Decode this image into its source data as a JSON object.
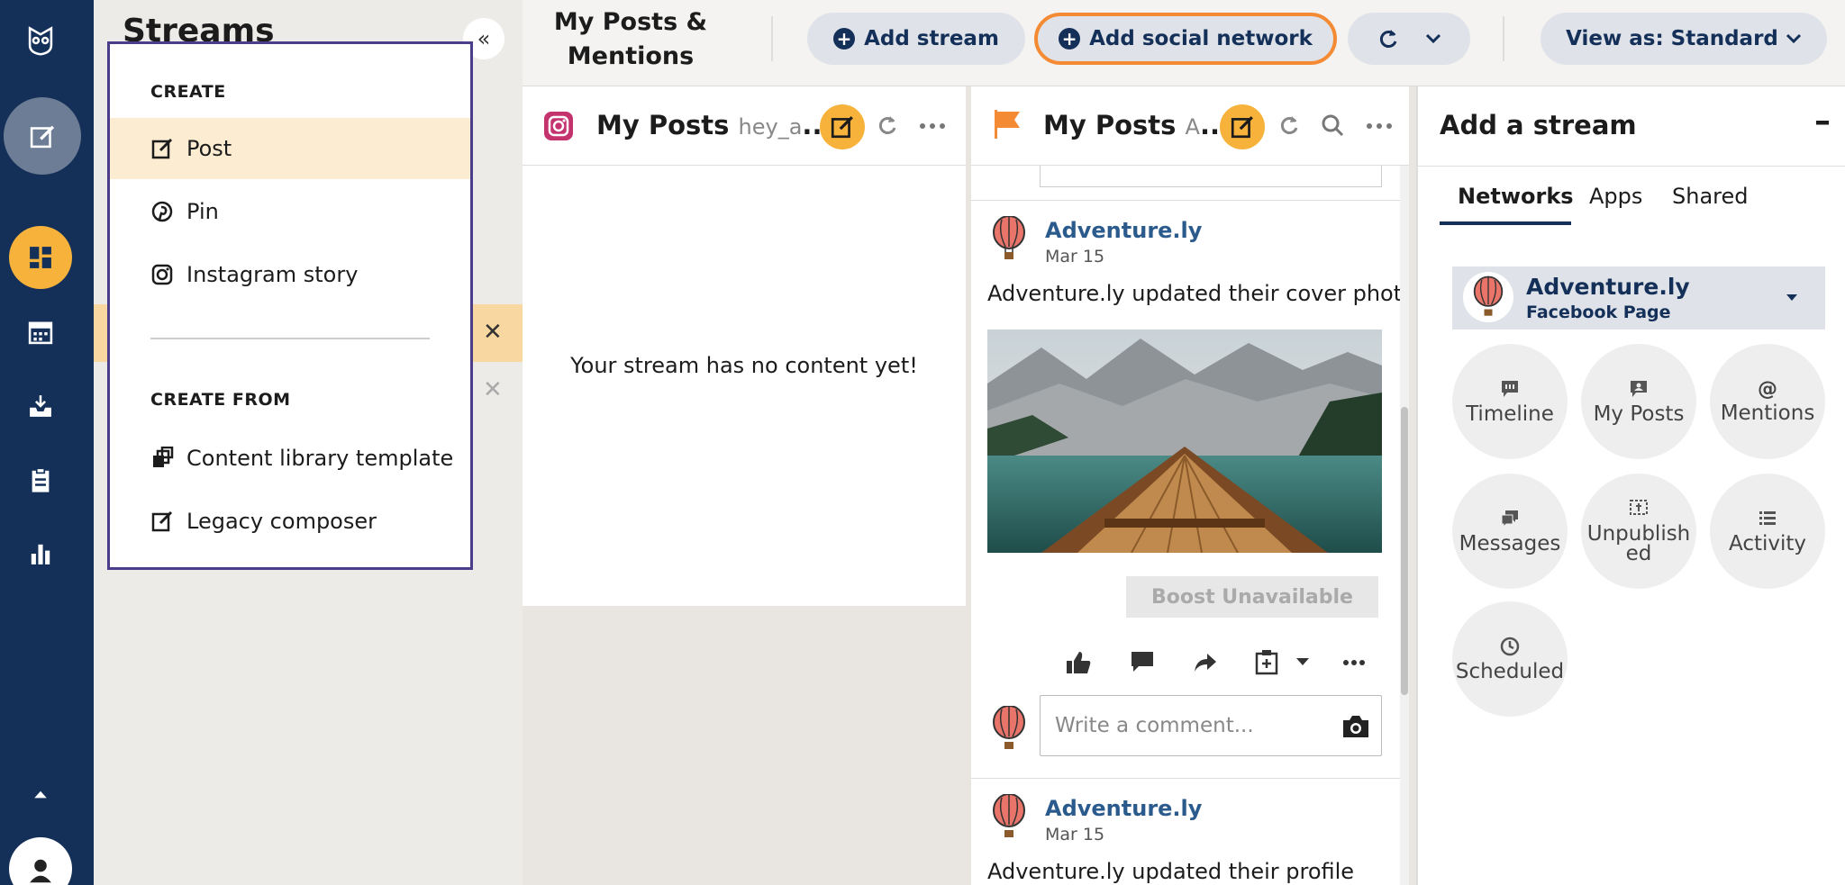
{
  "streams_panel": {
    "title": "Streams",
    "collapse_glyph": "«",
    "close_glyph": "✕"
  },
  "create_menu": {
    "create_header": "CREATE",
    "items": [
      {
        "label": "Post",
        "icon": "compose-icon"
      },
      {
        "label": "Pin",
        "icon": "pinterest-icon"
      },
      {
        "label": "Instagram story",
        "icon": "instagram-icon"
      }
    ],
    "create_from_header": "CREATE FROM",
    "from_items": [
      {
        "label": "Content library template",
        "icon": "template-icon"
      },
      {
        "label": "Legacy composer",
        "icon": "compose-icon"
      }
    ]
  },
  "topbar": {
    "title": "My Posts & Mentions",
    "add_stream": "Add stream",
    "add_social_network": "Add social network",
    "view_as": "View as: Standard"
  },
  "column1": {
    "title": "My Posts",
    "subtitle": "hey_a",
    "ellipsis": "...",
    "empty_message": "Your stream has no content yet!"
  },
  "column2": {
    "title": "My Posts",
    "subtitle": "A",
    "ellipsis": "...",
    "post1": {
      "author": "Adventure.ly",
      "date": "Mar 15",
      "text": "Adventure.ly updated their cover photo.",
      "boost": "Boost Unavailable",
      "comment_placeholder": "Write a comment..."
    },
    "post2": {
      "author": "Adventure.ly",
      "date": "Mar 15",
      "text": "Adventure.ly updated their profile"
    }
  },
  "add_panel": {
    "title": "Add a stream",
    "minimize_glyph": "–",
    "tabs": [
      "Networks",
      "Apps",
      "Shared"
    ],
    "account": {
      "name": "Adventure.ly",
      "type": "Facebook Page"
    },
    "streams": [
      {
        "label": "Timeline",
        "icon": "timeline-icon"
      },
      {
        "label": "My Posts",
        "icon": "my-posts-icon"
      },
      {
        "label": "Mentions",
        "icon": "at-icon"
      },
      {
        "label": "Messages",
        "icon": "messages-icon"
      },
      {
        "label": "Unpublished",
        "line1": "Unpublish",
        "line2": "ed",
        "icon": "unpublished-icon"
      },
      {
        "label": "Activity",
        "icon": "list-icon"
      },
      {
        "label": "Scheduled",
        "icon": "clock-icon"
      }
    ]
  },
  "colors": {
    "rail": "#143059",
    "accent_orange": "#f6b23a",
    "highlight_border": "#f48a33",
    "menu_border": "#4b3d8a",
    "link_blue": "#2b5a8c"
  }
}
